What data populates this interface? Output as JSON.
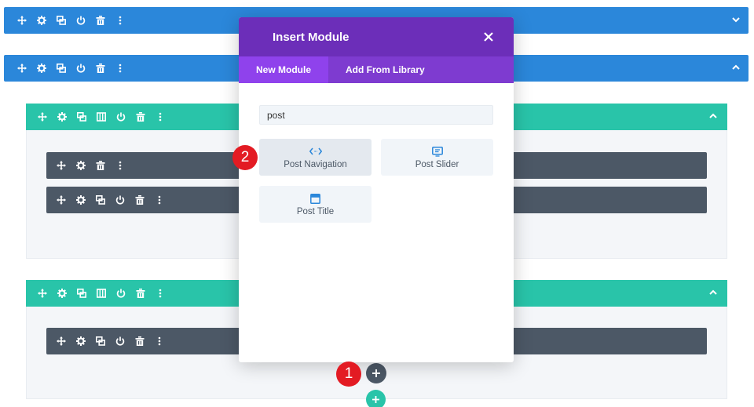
{
  "colors": {
    "section": "#2b87da",
    "row": "#29c4a9",
    "module": "#4c5866",
    "modal_header": "#6c2eb9",
    "modal_tabs": "#7e3bd0",
    "badge": "#e31b23"
  },
  "section_icons": [
    "move-icon",
    "gear-icon",
    "duplicate-icon",
    "power-icon",
    "trash-icon",
    "more-icon"
  ],
  "row_icons": [
    "move-icon",
    "gear-icon",
    "duplicate-icon",
    "columns-icon",
    "power-icon",
    "trash-icon",
    "more-icon"
  ],
  "modal": {
    "title": "Insert Module",
    "close_icon": "close-icon",
    "tabs": [
      {
        "label": "New Module",
        "active": true
      },
      {
        "label": "Add From Library",
        "active": false
      }
    ],
    "search_value": "post",
    "modules": [
      {
        "label": "Post Navigation",
        "icon": "code-arrows-icon"
      },
      {
        "label": "Post Slider",
        "icon": "slider-icon"
      },
      {
        "label": "Post Title",
        "icon": "title-icon"
      }
    ]
  },
  "badges": {
    "one": "1",
    "two": "2"
  }
}
